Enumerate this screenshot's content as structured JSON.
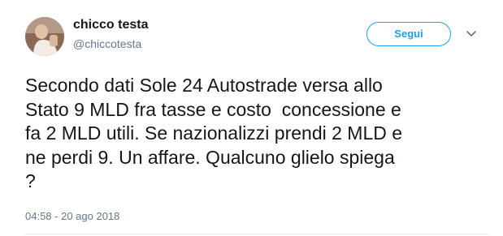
{
  "author": {
    "display_name": "chicco testa",
    "handle": "@chiccotesta"
  },
  "actions": {
    "follow_label": "Segui",
    "more_icon": "chevron-down-icon"
  },
  "tweet": {
    "text": "Secondo dati Sole 24 Autostrade versa allo\nStato 9 MLD fra tasse e costo  concessione e\nfa 2 MLD utili. Se nazionalizzi prendi 2 MLD e\nne perdi 9. Un affare. Qualcuno glielo spiega\n?",
    "timestamp": "04:58 - 20 ago 2018"
  },
  "colors": {
    "accent": "#1da1f2",
    "text": "#14171a",
    "secondary_text": "#657786"
  }
}
